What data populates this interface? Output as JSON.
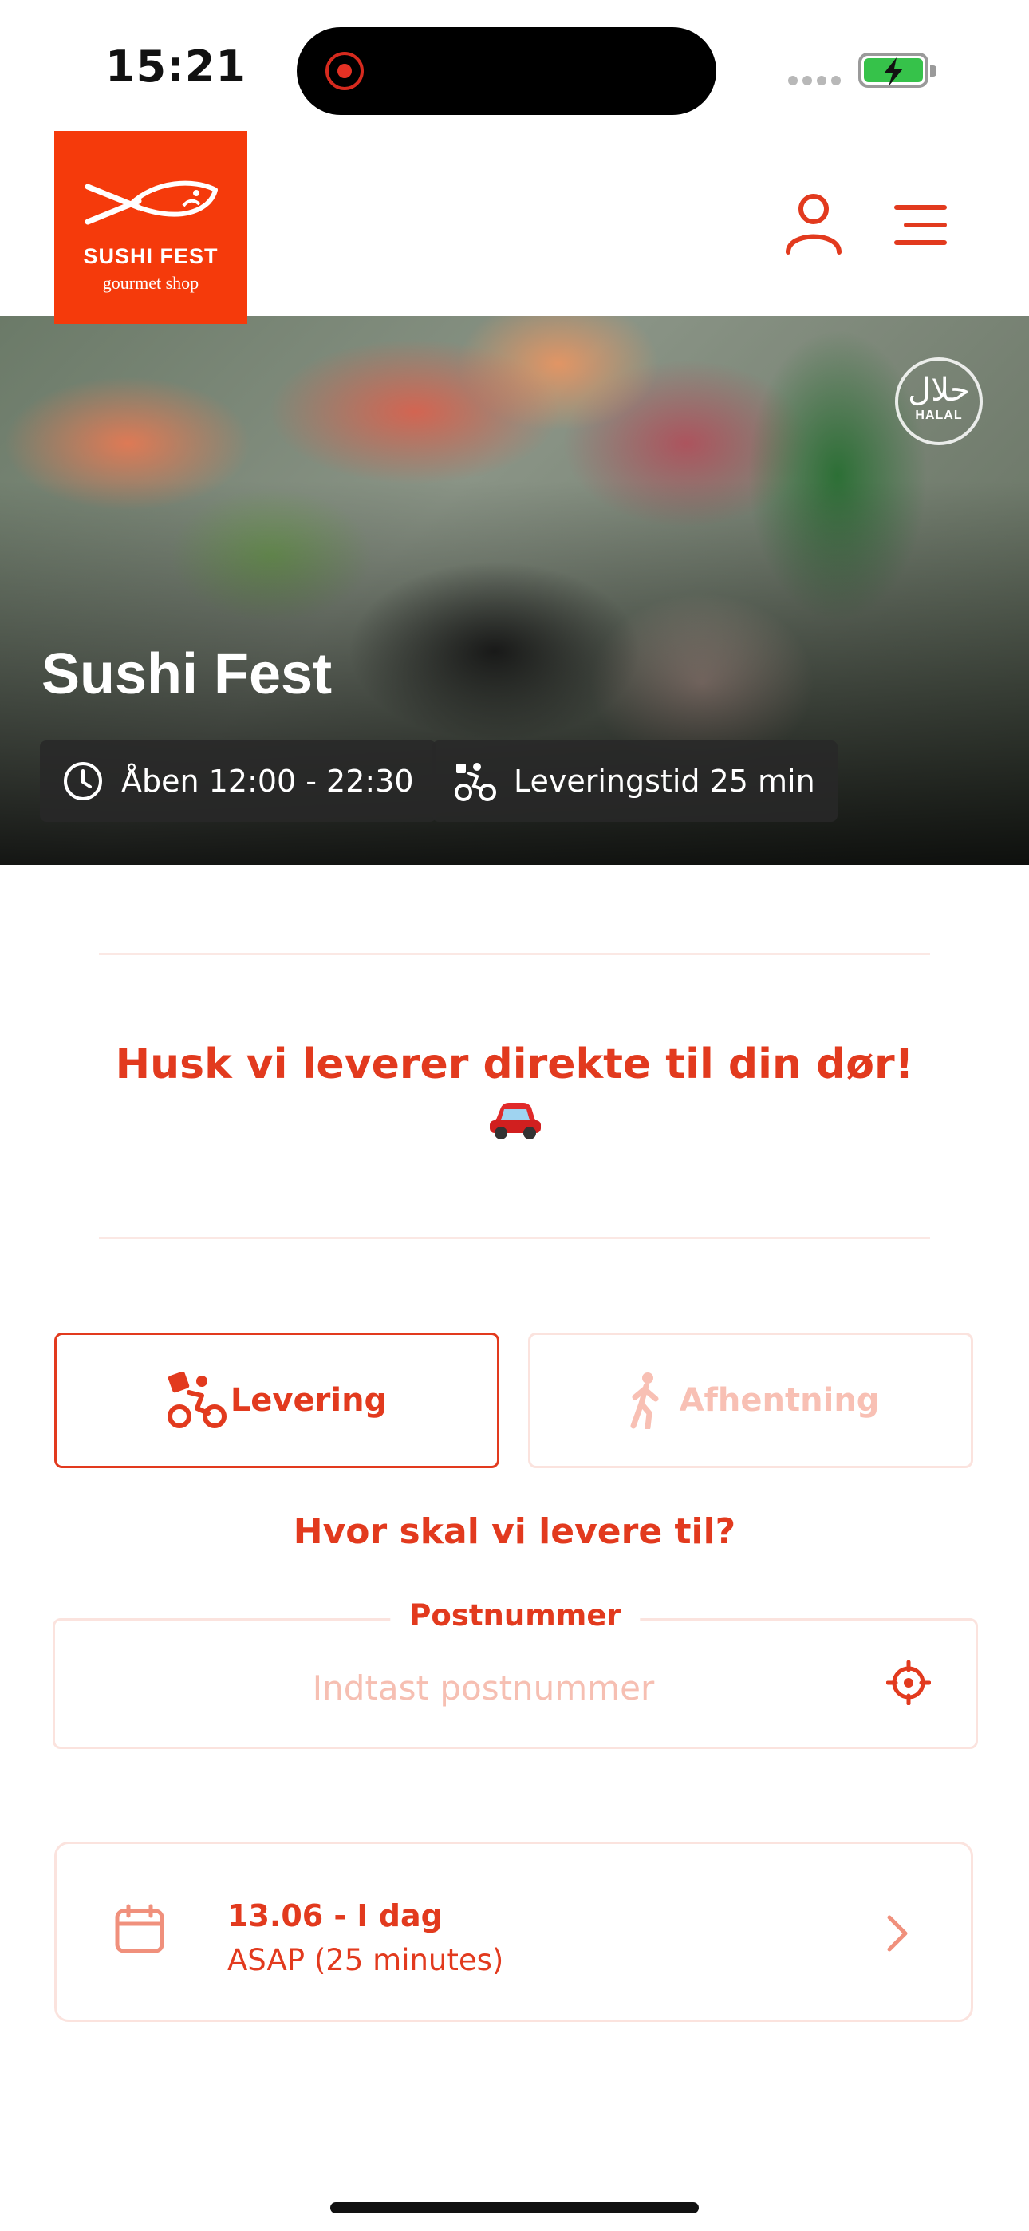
{
  "status_bar": {
    "time": "15:21"
  },
  "brand": {
    "name": "SUSHI FEST",
    "tagline": "gourmet shop",
    "color": "#f53a0b"
  },
  "header": {
    "user_icon": "user-icon",
    "menu_icon": "menu-icon"
  },
  "hero": {
    "title": "Sushi Fest",
    "badge": "HALAL",
    "badge_arabic": "حلال",
    "open_hours": "Åben 12:00 - 22:30",
    "delivery_time": "Leveringstid 25 min"
  },
  "promo": {
    "text": "Husk vi leverer direkte til din dør!",
    "emoji": "🚗"
  },
  "order_mode": {
    "options": [
      {
        "label": "Levering",
        "icon": "delivery-bike-icon",
        "selected": true
      },
      {
        "label": "Afhentning",
        "icon": "walking-person-icon",
        "selected": false
      }
    ]
  },
  "address": {
    "question": "Hvor skal vi levere til?",
    "field_label": "Postnummer",
    "placeholder": "Indtast postnummer",
    "value": ""
  },
  "schedule": {
    "date": "13.06 - I dag",
    "time": "ASAP (25 minutes)"
  },
  "colors": {
    "accent": "#e23a1e",
    "accent_light": "#fbe3de",
    "placeholder": "#f6bfb2"
  }
}
